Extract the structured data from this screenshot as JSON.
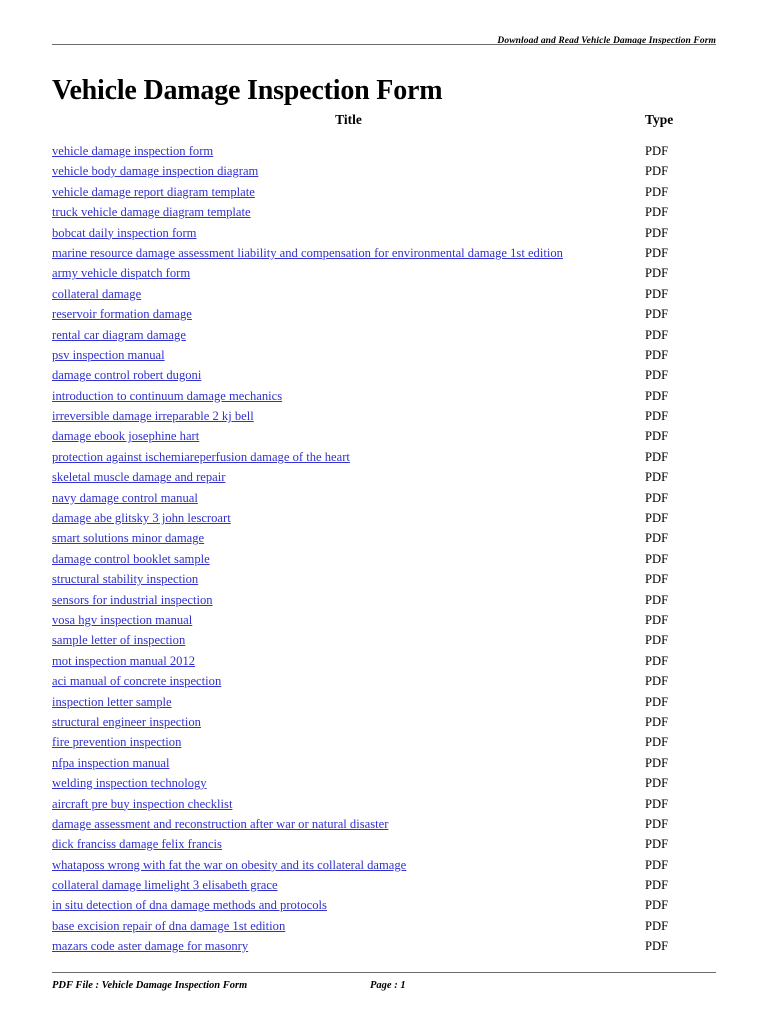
{
  "header": {
    "running_head": "Download and Read Vehicle Damage Inspection Form"
  },
  "title": "Vehicle Damage Inspection Form",
  "table": {
    "columns": {
      "title": "Title",
      "type": "Type"
    },
    "rows": [
      {
        "title": "vehicle damage inspection form",
        "type": "PDF"
      },
      {
        "title": "vehicle body damage inspection diagram",
        "type": "PDF"
      },
      {
        "title": "vehicle damage report diagram template",
        "type": "PDF"
      },
      {
        "title": "truck vehicle damage diagram template",
        "type": "PDF"
      },
      {
        "title": "bobcat daily inspection form",
        "type": "PDF"
      },
      {
        "title": "marine resource damage assessment liability and compensation for environmental damage 1st edition",
        "type": "PDF"
      },
      {
        "title": "army vehicle dispatch form",
        "type": "PDF"
      },
      {
        "title": "collateral damage",
        "type": "PDF"
      },
      {
        "title": "reservoir formation damage",
        "type": "PDF"
      },
      {
        "title": "rental car diagram damage",
        "type": "PDF"
      },
      {
        "title": "psv inspection manual",
        "type": "PDF"
      },
      {
        "title": "damage control robert dugoni",
        "type": "PDF"
      },
      {
        "title": "introduction to continuum damage mechanics",
        "type": "PDF"
      },
      {
        "title": "irreversible damage irreparable 2 kj bell",
        "type": "PDF"
      },
      {
        "title": "damage ebook josephine hart",
        "type": "PDF"
      },
      {
        "title": "protection against ischemiareperfusion damage of the heart",
        "type": "PDF"
      },
      {
        "title": "skeletal muscle damage and repair",
        "type": "PDF"
      },
      {
        "title": "navy damage control manual",
        "type": "PDF"
      },
      {
        "title": "damage abe glitsky 3 john lescroart",
        "type": "PDF"
      },
      {
        "title": "smart solutions minor damage",
        "type": "PDF"
      },
      {
        "title": "damage control booklet sample",
        "type": "PDF"
      },
      {
        "title": "structural stability inspection",
        "type": "PDF"
      },
      {
        "title": "sensors for industrial inspection",
        "type": "PDF"
      },
      {
        "title": "vosa hgv inspection manual",
        "type": "PDF"
      },
      {
        "title": "sample letter of inspection",
        "type": "PDF"
      },
      {
        "title": "mot inspection manual 2012",
        "type": "PDF"
      },
      {
        "title": "aci manual of concrete inspection",
        "type": "PDF"
      },
      {
        "title": "inspection letter sample",
        "type": "PDF"
      },
      {
        "title": "structural engineer inspection",
        "type": "PDF"
      },
      {
        "title": "fire prevention inspection",
        "type": "PDF"
      },
      {
        "title": "nfpa inspection manual",
        "type": "PDF"
      },
      {
        "title": "welding inspection technology",
        "type": "PDF"
      },
      {
        "title": "aircraft pre buy inspection checklist",
        "type": "PDF"
      },
      {
        "title": "damage assessment and reconstruction after war or natural disaster",
        "type": "PDF"
      },
      {
        "title": "dick franciss damage felix francis",
        "type": "PDF"
      },
      {
        "title": "whataposs wrong with fat the war on obesity and its collateral damage",
        "type": "PDF"
      },
      {
        "title": "collateral damage limelight 3 elisabeth grace",
        "type": "PDF"
      },
      {
        "title": "in situ detection of dna damage methods and protocols",
        "type": "PDF"
      },
      {
        "title": "base excision repair of dna damage 1st edition",
        "type": "PDF"
      },
      {
        "title": "mazars code aster damage for masonry",
        "type": "PDF"
      }
    ]
  },
  "footer": {
    "file_label": "PDF File : Vehicle Damage Inspection Form",
    "page_label": "Page : 1"
  },
  "colors": {
    "link": "#3131cf",
    "rule": "#6b6b6b",
    "text": "#000000"
  }
}
